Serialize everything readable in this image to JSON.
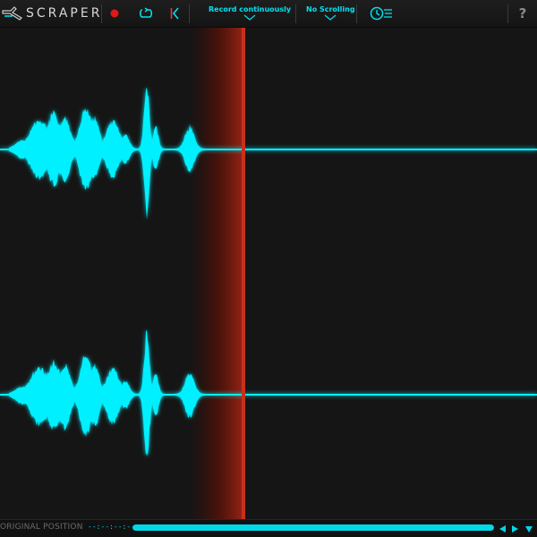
{
  "app": {
    "title": "SCRAPER",
    "logo_icon": "scraper-blade-icon"
  },
  "toolbar": {
    "record_icon": "record-icon",
    "loop_icon": "loop-icon",
    "return_icon": "return-to-start-icon",
    "record_mode": {
      "label": "Record continuously",
      "icon": "chevron-down-icon"
    },
    "scroll_mode": {
      "label": "No Scrolling",
      "icon": "chevron-down-icon"
    },
    "speed_icon": "clock-speed-icon",
    "help_label": "?"
  },
  "waveform": {
    "channels": 2,
    "playhead_fraction": 0.453,
    "wave_color": "#00f0ff",
    "playhead_color": "#c8301c",
    "background": "#151515"
  },
  "footer": {
    "position_label": "ORIGINAL POSITION",
    "position_readout": "--:--:--:--",
    "scroll_fill_fraction": 1.0,
    "prev_icon": "arrow-left-icon",
    "next_icon": "arrow-right-icon",
    "down_icon": "arrow-down-icon"
  },
  "colors": {
    "accent": "#00e2f0",
    "record": "#e01818",
    "return": "#e23a3a"
  }
}
